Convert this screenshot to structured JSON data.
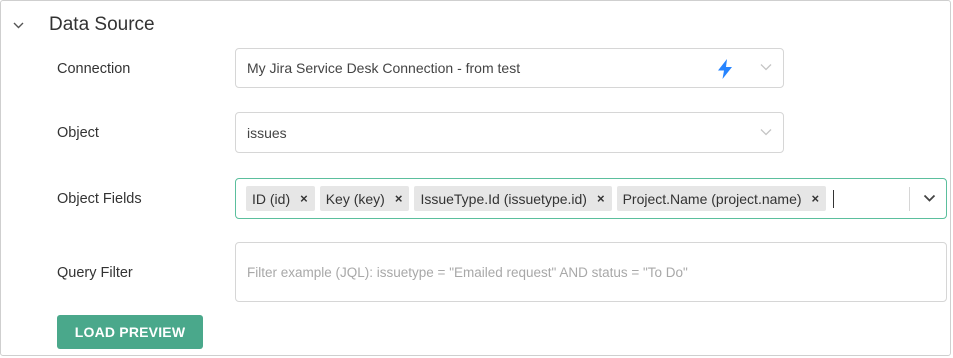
{
  "section": {
    "title": "Data Source"
  },
  "connection": {
    "label": "Connection",
    "value": "My Jira Service Desk Connection - from test"
  },
  "object": {
    "label": "Object",
    "value": "issues"
  },
  "object_fields": {
    "label": "Object Fields",
    "selected": [
      "ID (id)",
      "Key (key)",
      "IssueType.Id (issuetype.id)",
      "Project.Name (project.name)"
    ],
    "remove_symbol": "×"
  },
  "query_filter": {
    "label": "Query Filter",
    "placeholder": "Filter example (JQL): issuetype = \"Emailed request\" AND status = \"To Do\""
  },
  "actions": {
    "load_preview": "LOAD PREVIEW"
  },
  "colors": {
    "accent": "#4aa88b",
    "focus_border": "#5bbf9d",
    "bolt": "#2684ff",
    "chip_bg": "#e6e6e6"
  },
  "icons": {
    "collapse": "chevron-down-icon",
    "connection_type": "lightning-bolt-icon",
    "dropdown": "chevron-down-icon"
  }
}
